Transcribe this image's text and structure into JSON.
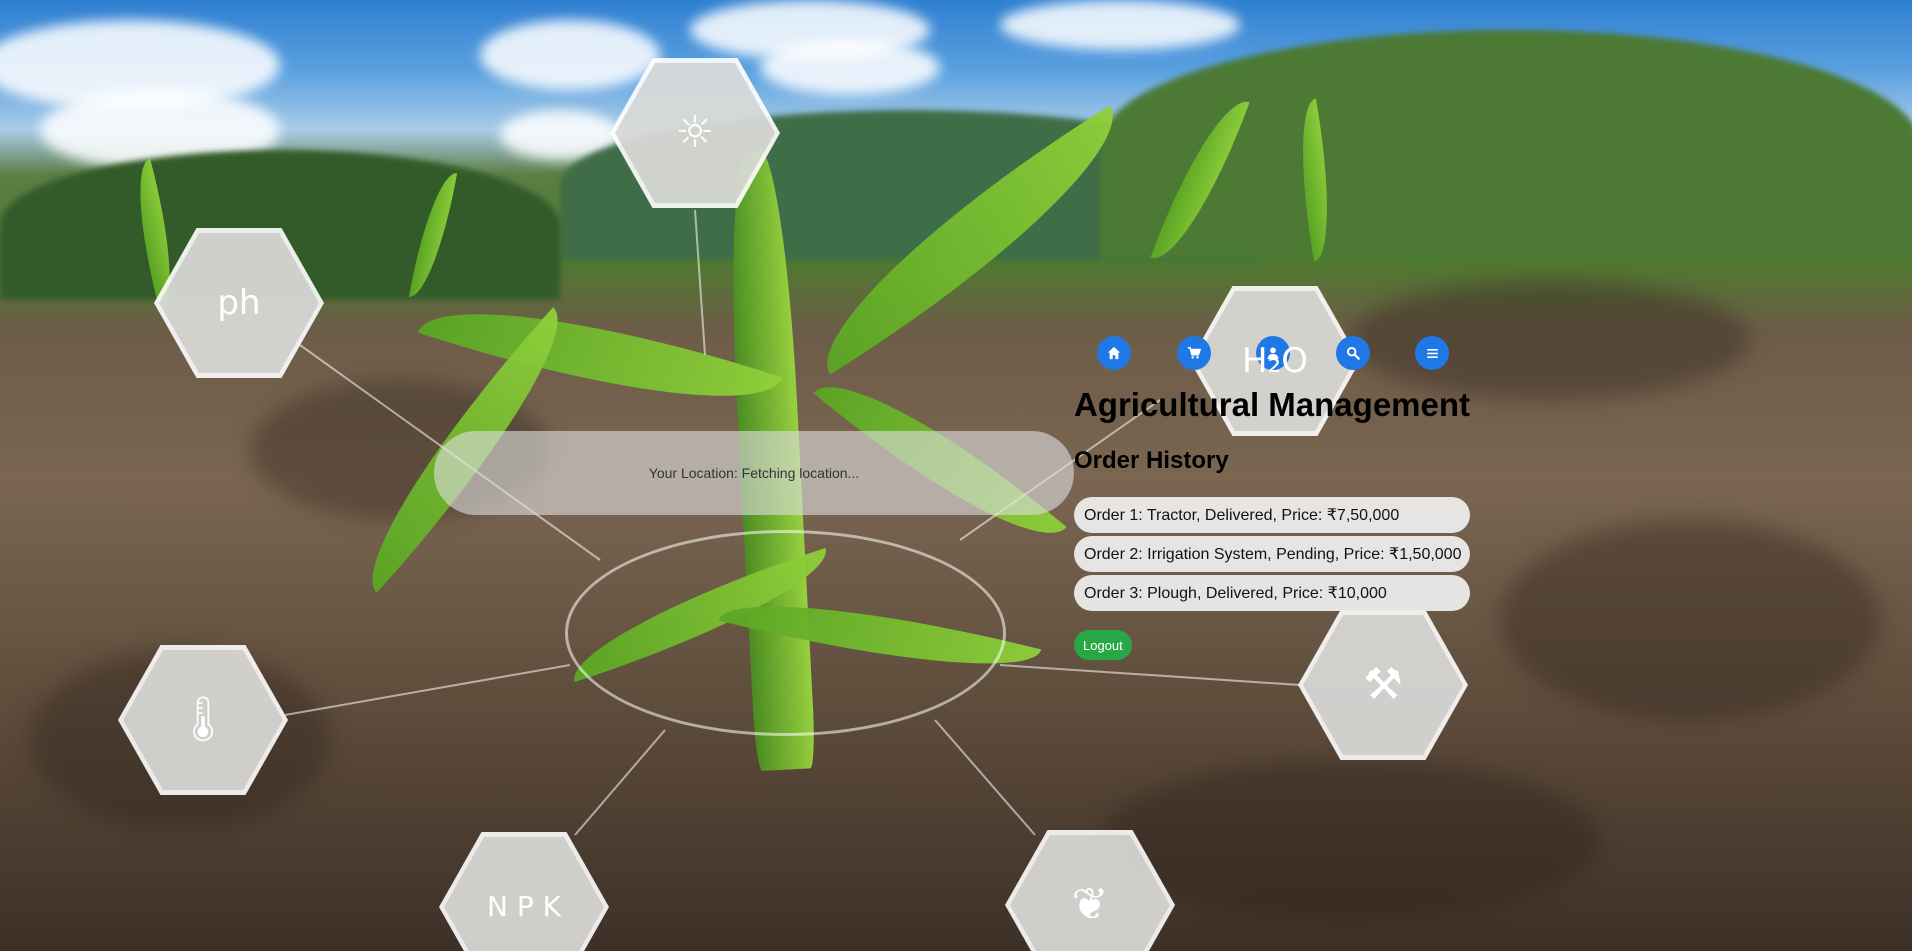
{
  "colors": {
    "nav_button": "#1f78e6",
    "logout_button": "#28a745",
    "order_item_bg": "#ececec"
  },
  "nav": {
    "items": [
      {
        "icon": "home-icon",
        "label": "Home"
      },
      {
        "icon": "cart-icon",
        "label": "Cart"
      },
      {
        "icon": "user-icon",
        "label": "Profile"
      },
      {
        "icon": "search-icon",
        "label": "Search"
      },
      {
        "icon": "menu-icon",
        "label": "Menu"
      }
    ]
  },
  "location": {
    "text": "Your Location: Fetching location..."
  },
  "header": {
    "title": "Agricultural Management"
  },
  "order_history": {
    "title": "Order History",
    "orders": [
      "Order 1: Tractor, Delivered, Price: ₹7,50,000",
      "Order 2: Irrigation System, Pending, Price: ₹1,50,000",
      "Order 3: Plough, Delivered, Price: ₹10,000"
    ]
  },
  "logout": {
    "label": "Logout"
  },
  "background": {
    "hex_icons": [
      "sun-icon",
      "ph-icon",
      "h2o-icon",
      "thermometer-icon",
      "shovel-icon",
      "npk-icon",
      "leaf-icon"
    ]
  }
}
